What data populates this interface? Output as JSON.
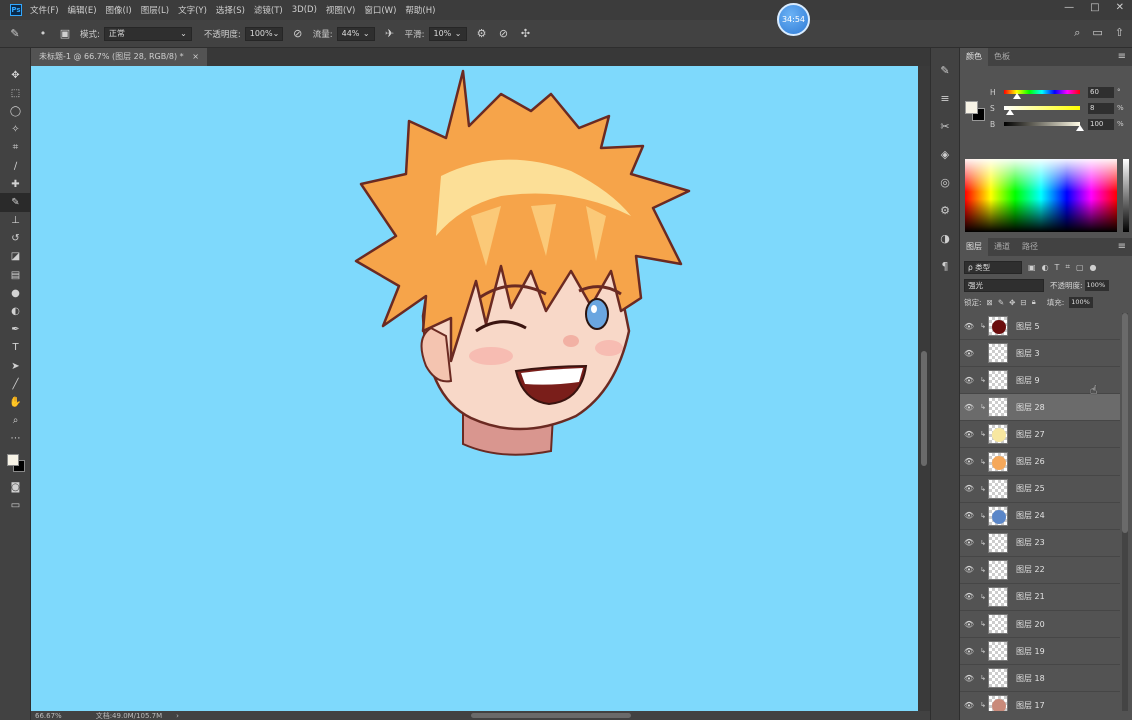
{
  "menubar": {
    "logo": "Ps",
    "items": [
      "文件(F)",
      "编辑(E)",
      "图像(I)",
      "图层(L)",
      "文字(Y)",
      "选择(S)",
      "滤镜(T)",
      "3D(D)",
      "视图(V)",
      "窗口(W)",
      "帮助(H)"
    ],
    "window_controls": [
      "—",
      "□",
      "✕"
    ]
  },
  "timer": "34:54",
  "options": {
    "mode_label": "模式:",
    "mode_value": "正常",
    "opacity_label": "不透明度:",
    "opacity_value": "100%",
    "flow_label": "流量:",
    "flow_value": "44%",
    "smooth_label": "平滑:",
    "smooth_value": "10%"
  },
  "document": {
    "tab_title": "未标题-1 @ 66.7% (图层 28, RGB/8) *",
    "close": "×",
    "zoom": "66.67%",
    "doc_info": "文档:49.0M/105.7M",
    "canvas_color": "#7ed9fc"
  },
  "color_panel": {
    "tabs": [
      "颜色",
      "色板"
    ],
    "foreground": "#f7f3e6",
    "background": "#000000",
    "sliders": [
      {
        "label": "H",
        "value": "60",
        "unit": "°",
        "level": 0.17
      },
      {
        "label": "S",
        "value": "8",
        "unit": "%",
        "level": 0.08
      },
      {
        "label": "B",
        "value": "100",
        "unit": "%",
        "level": 1.0
      }
    ]
  },
  "layers_panel": {
    "tabs": [
      "图层",
      "通道",
      "路径"
    ],
    "filter_kind": "ρ 类型",
    "blend_mode": "强光",
    "opacity_label": "不透明度:",
    "opacity_value": "100%",
    "lock_label": "锁定:",
    "fill_label": "填充:",
    "fill_value": "100%",
    "layers": [
      {
        "name": "图层 5",
        "clipped": true,
        "thumb": "#6b0d0d",
        "selected": false
      },
      {
        "name": "图层 3",
        "clipped": false,
        "thumb": "",
        "selected": false
      },
      {
        "name": "图层 9",
        "clipped": true,
        "thumb": "",
        "selected": false
      },
      {
        "name": "图层 28",
        "clipped": true,
        "thumb": "",
        "selected": true
      },
      {
        "name": "图层 27",
        "clipped": true,
        "thumb": "#f7e7a0",
        "selected": false
      },
      {
        "name": "图层 26",
        "clipped": true,
        "thumb": "#f5a85a",
        "selected": false
      },
      {
        "name": "图层 25",
        "clipped": true,
        "thumb": "",
        "selected": false
      },
      {
        "name": "图层 24",
        "clipped": true,
        "thumb": "#5a86c8",
        "selected": false
      },
      {
        "name": "图层 23",
        "clipped": true,
        "thumb": "",
        "selected": false
      },
      {
        "name": "图层 22",
        "clipped": true,
        "thumb": "",
        "selected": false
      },
      {
        "name": "图层 21",
        "clipped": true,
        "thumb": "",
        "selected": false
      },
      {
        "name": "图层 20",
        "clipped": true,
        "thumb": "",
        "selected": false
      },
      {
        "name": "图层 19",
        "clipped": true,
        "thumb": "",
        "selected": false
      },
      {
        "name": "图层 18",
        "clipped": true,
        "thumb": "",
        "selected": false
      },
      {
        "name": "图层 17",
        "clipped": true,
        "thumb": "#c98a7a",
        "selected": false
      }
    ]
  }
}
